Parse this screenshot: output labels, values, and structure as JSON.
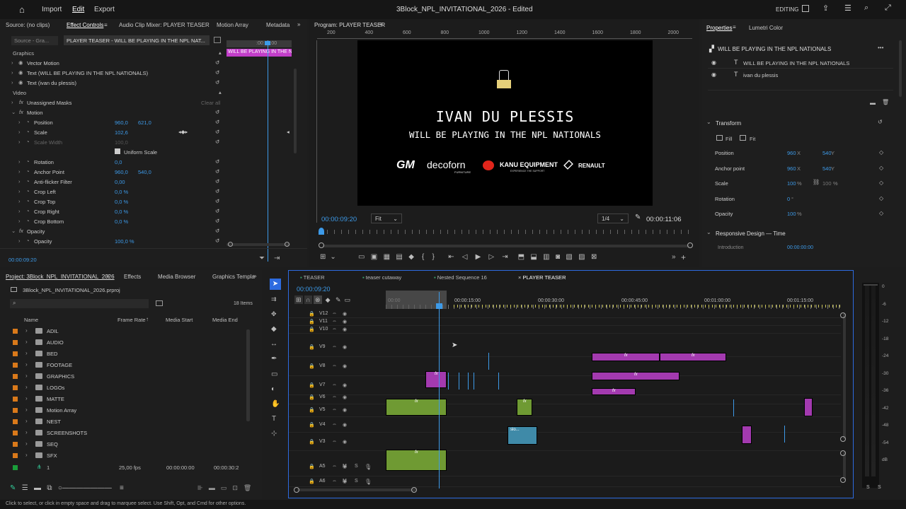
{
  "topbar": {
    "home": "home-icon",
    "menu": [
      "Import",
      "Edit",
      "Export"
    ],
    "title": "3Block_NPL_INVITATIONAL_2026 - Edited",
    "workspace": "EDITING"
  },
  "source_panel": {
    "tabs": [
      "Source: (no clips)",
      "Effect Controls",
      "Audio Clip Mixer: PLAYER TEASER",
      "Motion Array",
      "Metadata"
    ],
    "source_sel": "Source - Gra...",
    "seq_sel": "PLAYER TEASER - WILL BE PLAYING IN THE NPL NAT...",
    "ruler_tc": ":00:10:00",
    "mini_clip": "WILL BE PLAYING IN THE N",
    "timecode": "00:00:09:20"
  },
  "effects": [
    {
      "label": "Graphics",
      "indent": 0,
      "type": "section"
    },
    {
      "label": "Vector Motion",
      "indent": 1,
      "type": "fx"
    },
    {
      "label": "Text (WILL BE PLAYING IN THE NPL NATIONALS)",
      "indent": 1,
      "type": "fx"
    },
    {
      "label": "Text (ivan du plessis)",
      "indent": 1,
      "type": "fx"
    },
    {
      "label": "Video",
      "indent": 0,
      "type": "section"
    },
    {
      "label": "Unassigned Masks",
      "indent": 1,
      "type": "plain",
      "extra": "Clear all"
    },
    {
      "label": "Motion",
      "indent": 1,
      "type": "fx"
    },
    {
      "label": "Position",
      "indent": 2,
      "type": "prop",
      "v1": "960,0",
      "v2": "621,0"
    },
    {
      "label": "Scale",
      "indent": 2,
      "type": "prop",
      "v1": "102,6"
    },
    {
      "label": "Scale Width",
      "indent": 2,
      "type": "dim",
      "v1": "100,0"
    },
    {
      "label": "Uniform Scale",
      "indent": 2,
      "type": "check"
    },
    {
      "label": "Rotation",
      "indent": 2,
      "type": "prop",
      "v1": "0,0"
    },
    {
      "label": "Anchor Point",
      "indent": 2,
      "type": "prop",
      "v1": "960,0",
      "v2": "540,0"
    },
    {
      "label": "Anti-flicker Filter",
      "indent": 2,
      "type": "prop",
      "v1": "0,00"
    },
    {
      "label": "Crop Left",
      "indent": 2,
      "type": "prop",
      "v1": "0,0 %"
    },
    {
      "label": "Crop Top",
      "indent": 2,
      "type": "prop",
      "v1": "0,0 %"
    },
    {
      "label": "Crop Right",
      "indent": 2,
      "type": "prop",
      "v1": "0,0 %"
    },
    {
      "label": "Crop Bottom",
      "indent": 2,
      "type": "prop",
      "v1": "0,0 %"
    },
    {
      "label": "Opacity",
      "indent": 1,
      "type": "fx"
    },
    {
      "label": "Opacity",
      "indent": 2,
      "type": "prop",
      "v1": "100,0 %"
    }
  ],
  "program": {
    "tab": "Program: PLAYER TEASER",
    "ruler": [
      "200",
      "400",
      "600",
      "800",
      "1000",
      "1200",
      "1400",
      "1600",
      "1800",
      "2000"
    ],
    "name": "IVAN DU PLESSIS",
    "sub": "WILL BE PLAYING IN THE NPL NATIONALS",
    "sponsors": [
      "GM",
      "decoforn",
      "KANU EQUIPMENT",
      "RENAULT"
    ],
    "sponsor_small": [
      "FURNITURE",
      "EXPERIENCE THE SUPPORT"
    ],
    "tc": "00:00:09:20",
    "fit": "Fit",
    "quality": "1/4",
    "duration": "00:00:11:06"
  },
  "properties": {
    "tabs": [
      "Properties",
      "Lumetri Color"
    ],
    "heading": "WILL BE PLAYING IN THE NPL NATIONALS",
    "layers": [
      "WILL BE PLAYING IN THE NPL NATIONALS",
      "ivan du plessis"
    ],
    "transform": "Transform",
    "fill": "Fill",
    "fit": "Fit",
    "rows": [
      {
        "label": "Position",
        "x": "960",
        "y": "540"
      },
      {
        "label": "Anchor point",
        "x": "960",
        "y": "540"
      },
      {
        "label": "Scale",
        "x": "100",
        "y": "100"
      },
      {
        "label": "Rotation",
        "x": "0",
        "y": ""
      },
      {
        "label": "Opacity",
        "x": "100",
        "y": ""
      }
    ],
    "responsive": "Responsive Design — Time",
    "intro": "Introduction",
    "intro_val": "00:00:00:00"
  },
  "project": {
    "tabs": [
      "Project: 3Block_NPL_INVITATIONAL_2026",
      "Effects",
      "Media Browser",
      "Graphics Templa"
    ],
    "file": "3Block_NPL_INVITATIONAL_2026.prproj",
    "items_count": "18 Items",
    "cols": [
      "Name",
      "Frame Rate",
      "Media Start",
      "Media End"
    ],
    "items": [
      "ADIL",
      "AUDIO",
      "BED",
      "FOOTAGE",
      "GRAPHICS",
      "LOGOs",
      "MATTE",
      "Motion Array",
      "NEST",
      "SCREENSHOTS",
      "SEQ",
      "SFX"
    ],
    "last": {
      "name": "1",
      "fps": "25,00 fps",
      "start": "00:00:00:00",
      "end": "00:00:30:2"
    }
  },
  "timeline": {
    "tabs": [
      "TEASER",
      "teaser cutaway",
      "Nested Sequence 16",
      "PLAYER TEASER"
    ],
    "tc": "00:00:09:20",
    "ruler": [
      "00:00",
      "00:00:15:00",
      "00:00:30:00",
      "00:00:45:00",
      "00:01:00:00",
      "00:01:15:00"
    ],
    "tracks": [
      "V12",
      "V11",
      "V10",
      "V9",
      "V8",
      "V7",
      "V6",
      "V5",
      "V4",
      "V3",
      "A5",
      "A6"
    ],
    "fx_label": "fx",
    "clip_text": "slo..."
  },
  "meter": {
    "labels": [
      "0",
      "-6",
      "-12",
      "-18",
      "-24",
      "-30",
      "-36",
      "-42",
      "-48",
      "-54",
      "dB"
    ],
    "bottom": [
      "S",
      "S"
    ]
  },
  "status": "Click to select, or click in empty space and drag to marquee select. Use Shift, Opt, and Cmd for other options."
}
